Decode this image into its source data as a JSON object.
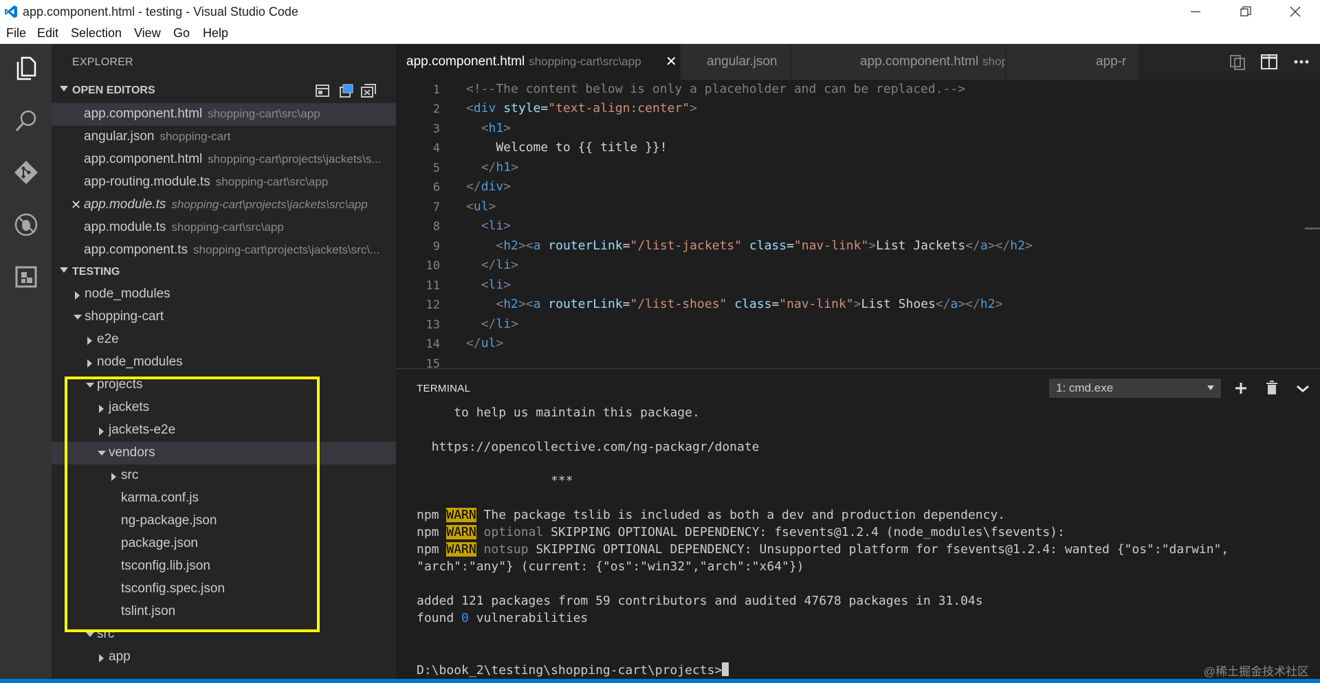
{
  "window": {
    "title": "app.component.html - testing - Visual Studio Code"
  },
  "menu": [
    "File",
    "Edit",
    "Selection",
    "View",
    "Go",
    "Help"
  ],
  "activity_bar": [
    "files-icon",
    "search-icon",
    "git-icon",
    "debug-icon",
    "extensions-icon"
  ],
  "sidebar": {
    "explorer_title": "EXPLORER",
    "open_editors_title": "OPEN EDITORS",
    "open_editors": [
      {
        "name": "app.component.html",
        "desc": "shopping-cart\\src\\app"
      },
      {
        "name": "angular.json",
        "desc": "shopping-cart"
      },
      {
        "name": "app.component.html",
        "desc": "shopping-cart\\projects\\jackets\\s..."
      },
      {
        "name": "app-routing.module.ts",
        "desc": "shopping-cart\\src\\app"
      },
      {
        "name": "app.module.ts",
        "desc": "shopping-cart\\projects\\jackets\\src\\app"
      },
      {
        "name": "app.module.ts",
        "desc": "shopping-cart\\src\\app"
      },
      {
        "name": "app.component.ts",
        "desc": "shopping-cart\\projects\\jackets\\src\\..."
      }
    ],
    "folder_title": "TESTING",
    "tree": [
      "node_modules",
      "shopping-cart",
      "e2e",
      "node_modules",
      "projects",
      "jackets",
      "jackets-e2e",
      "vendors",
      "src",
      "karma.conf.js",
      "ng-package.json",
      "package.json",
      "tsconfig.lib.json",
      "tsconfig.spec.json",
      "tslint.json",
      "src",
      "app"
    ],
    "highlight_color": "#ffff00"
  },
  "tabs": [
    {
      "name": "app.component.html",
      "desc": "shopping-cart\\src\\app",
      "close": "✕"
    },
    {
      "name": "angular.json",
      "desc": ""
    },
    {
      "name": "app.component.html",
      "desc": "shopping-cart\\projects\\jackets\\src\\app"
    },
    {
      "name": "app-r",
      "desc": ""
    }
  ],
  "editor": {
    "line_numbers": [
      "1",
      "2",
      "3",
      "4",
      "5",
      "6",
      "7",
      "8",
      "9",
      "10",
      "11",
      "12",
      "13",
      "14",
      "15"
    ],
    "lines": [
      "<!--The content below is only a placeholder and can be replaced.-->",
      "<div style=\"text-align:center\">",
      "  <h1>",
      "    Welcome to {{ title }}!",
      "  </h1>",
      "</div>",
      "<ul>",
      "  <li>",
      "    <h2><a routerLink=\"/list-jackets\" class=\"nav-link\">List Jackets</a></h2>",
      "  </li>",
      "  <li>",
      "    <h2><a routerLink=\"/list-shoes\" class=\"nav-link\">List Shoes</a></h2>",
      "  </li>",
      "</ul>",
      ""
    ]
  },
  "terminal": {
    "title": "TERMINAL",
    "selected_shell": "1: cmd.exe",
    "lines": {
      "l1": "     to help us maintain this package.",
      "l2": "  https://opencollective.com/ng-packagr/donate",
      "l3": "                  ***",
      "npm": "npm",
      "warn": "WARN",
      "w1": " The package tslib is included as both a dev and production dependency.",
      "w2a": " optional",
      "w2b": " SKIPPING OPTIONAL DEPENDENCY: fsevents@1.2.4 (node_modules\\fsevents):",
      "w3a": " notsup",
      "w3b": " SKIPPING OPTIONAL DEPENDENCY: Unsupported platform for fsevents@1.2.4: wanted {\"os\":\"darwin\",",
      "w4": "\"arch\":\"any\"} (current: {\"os\":\"win32\",\"arch\":\"x64\"})",
      "added": "added 121 packages from 59 contributors and audited 47678 packages in 31.04s",
      "found_a": "found ",
      "found_n": "0",
      "found_b": " vulnerabilities",
      "prompt": "D:\\book_2\\testing\\shopping-cart\\projects>"
    }
  },
  "watermark": "@稀土掘金技术社区"
}
